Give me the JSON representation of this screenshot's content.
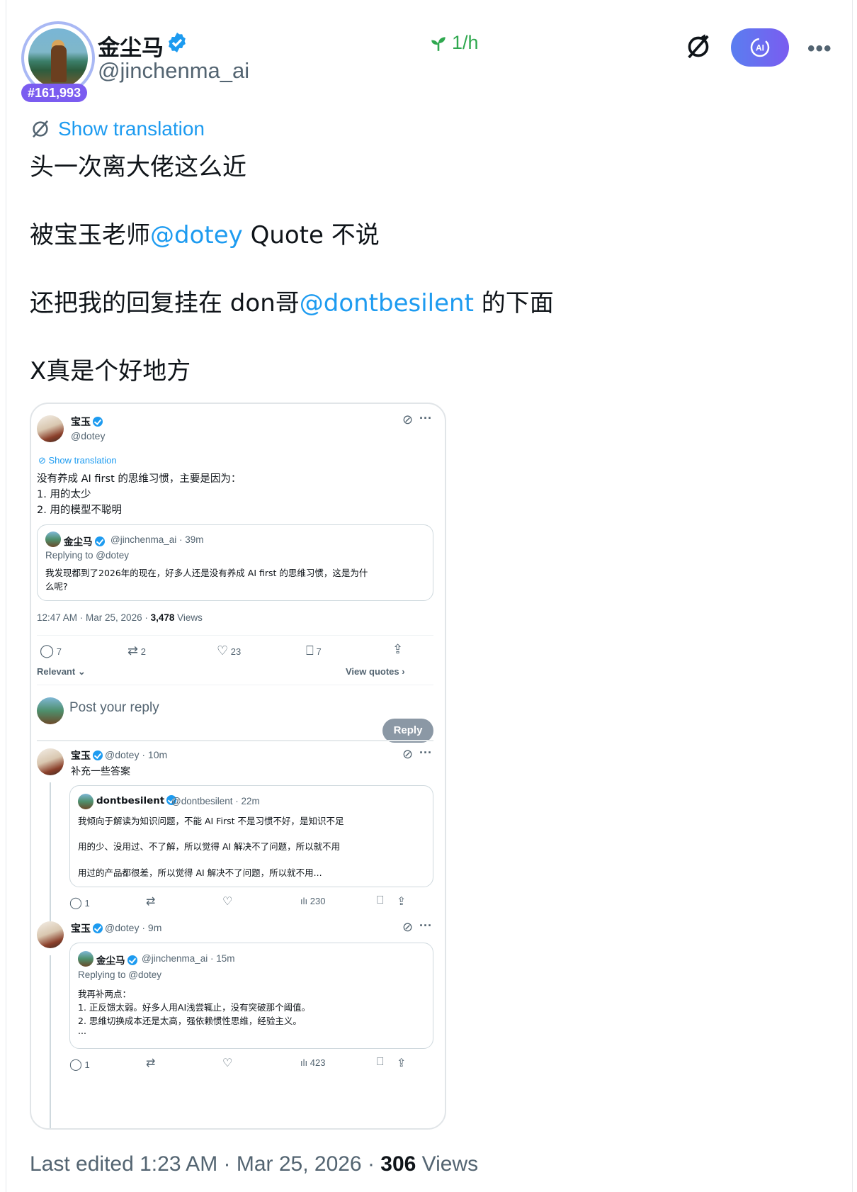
{
  "author": {
    "display_name": "金尘马",
    "handle": "@jinchenma_ai",
    "rank_badge": "#161,993",
    "rate": "1/h"
  },
  "actions": {
    "show_translation": "Show translation",
    "ai_label": "AI"
  },
  "post": {
    "line1": "头一次离大佬这么近",
    "line2_pre": "被宝玉老师",
    "line2_mention": "@dotey",
    "line2_post": " Quote 不说",
    "line3_pre": "还把我的回复挂在 don哥",
    "line3_mention": "@dontbesilent",
    "line3_post": " 的下面",
    "line4": "X真是个好地方"
  },
  "screenshot": {
    "main": {
      "name": "宝玉",
      "handle": "@dotey",
      "show_translation": "Show translation",
      "text1": "没有养成 AI first 的思维习惯，主要是因为：",
      "text2": "1. 用的太少",
      "text3": "2. 用的模型不聪明"
    },
    "quoted": {
      "name": "金尘马",
      "meta": "@jinchenma_ai · 39m",
      "replying": "Replying to @dotey",
      "text1": "我发现都到了2026年的现在，好多人还是没有养成 AI first 的思维习惯，这是为什",
      "text2": "么呢?"
    },
    "timestamp": "12:47 AM · Mar 25, 2026 · ",
    "views_count": "3,478",
    "views_label": " Views",
    "stats": {
      "replies": "7",
      "reposts": "2",
      "likes": "23",
      "bookmarks": "7"
    },
    "relevant": "Relevant",
    "view_quotes": "View quotes",
    "reply_placeholder": "Post your reply",
    "reply_button": "Reply",
    "reply1": {
      "name": "宝玉",
      "meta": "@dotey · 10m",
      "text": "补充一些答案",
      "quote_name": "dontbesilent",
      "quote_meta": "@dontbesilent · 22m",
      "q1": "我倾向于解读为知识问题，不能 AI First 不是习惯不好，是知识不足",
      "q2": "用的少、没用过、不了解，所以觉得 AI 解决不了问题，所以就不用",
      "q3": "用过的产品都很差，所以觉得 AI 解决不了问题，所以就不用...",
      "replies": "1",
      "views": "230"
    },
    "reply2": {
      "name": "宝玉",
      "meta": "@dotey · 9m",
      "quote_name": "金尘马",
      "quote_meta": "@jinchenma_ai · 15m",
      "replying": "Replying to @dotey",
      "q1": "我再补两点：",
      "q2": "1. 正反馈太弱。好多人用AI浅尝辄止，没有突破那个阈值。",
      "q3": "2. 思维切换成本还是太高，强依赖惯性思维，经验主义。",
      "q4": "...",
      "replies": "1",
      "views": "423"
    }
  },
  "footer": {
    "edited": "Last edited 1:23 AM · Mar 25, 2026 · ",
    "views_count": "306",
    "views_label": " Views"
  },
  "colors": {
    "link": "#1d9bf0",
    "muted": "#536471",
    "badge": "#7b5cf0",
    "rate": "#2fa84f"
  }
}
